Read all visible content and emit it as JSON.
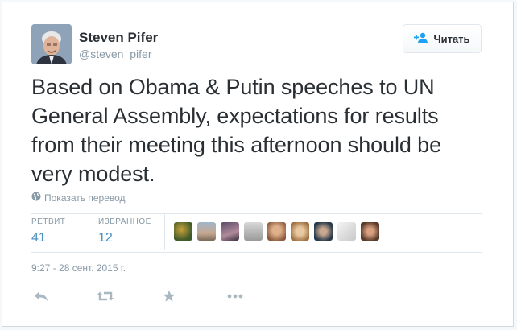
{
  "user": {
    "name": "Steven Pifer",
    "handle": "@steven_pifer"
  },
  "follow_label": "Читать",
  "tweet": {
    "line1": "Based on Obama & Putin speeches to UN",
    "line2": "General Assembly, expectations for results",
    "line3": "from their meeting this afternoon should be",
    "line4": "very modest."
  },
  "translate_label": "Показать перевод",
  "stats": {
    "retweets_label": "РЕТВИТ",
    "retweets": "41",
    "favorites_label": "ИЗБРАННОЕ",
    "favorites": "12"
  },
  "favoriters": [
    "avatar-1",
    "avatar-2",
    "avatar-3",
    "avatar-4",
    "avatar-5",
    "avatar-6",
    "avatar-7",
    "avatar-8",
    "avatar-9"
  ],
  "timestamp": "9:27 - 28 сент. 2015 г.",
  "colors": {
    "text": "#292f33",
    "muted": "#8899a6",
    "link": "#4a90c2",
    "border": "#e1e8ed"
  }
}
